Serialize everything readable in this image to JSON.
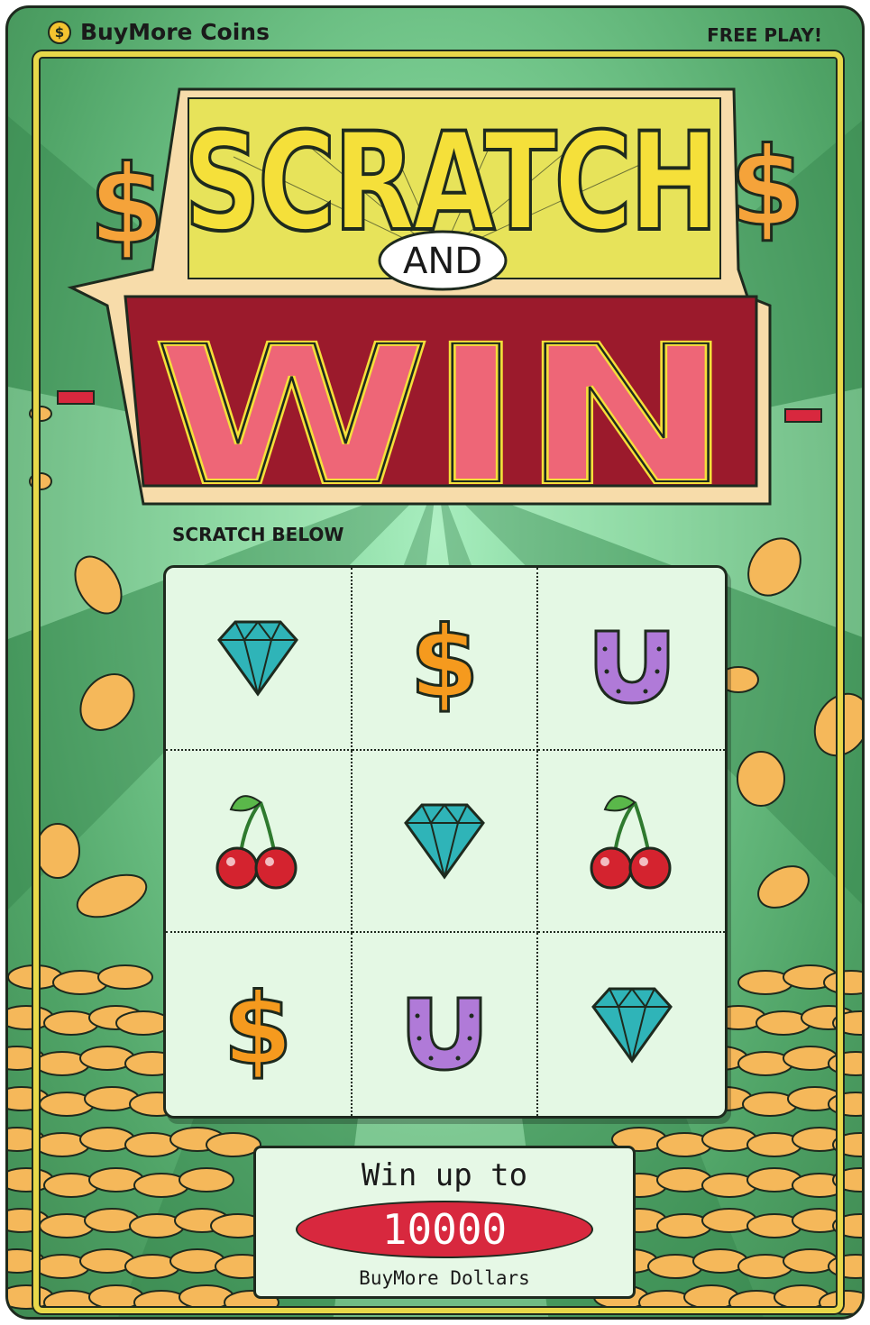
{
  "header": {
    "brand_icon_glyph": "$",
    "brand_name": "BuyMore Coins",
    "mode_label": "FREE PLAY!"
  },
  "logo": {
    "line1": "SCRATCH",
    "line2": "AND",
    "line3": "WIN"
  },
  "instruction": "SCRATCH BELOW",
  "grid": {
    "cells": [
      {
        "symbol": "diamond"
      },
      {
        "symbol": "dollar"
      },
      {
        "symbol": "horseshoe"
      },
      {
        "symbol": "cherry"
      },
      {
        "symbol": "diamond"
      },
      {
        "symbol": "cherry"
      },
      {
        "symbol": "dollar"
      },
      {
        "symbol": "horseshoe"
      },
      {
        "symbol": "diamond"
      }
    ]
  },
  "prize": {
    "title": "Win up to",
    "amount": "10000",
    "unit": "BuyMore Dollars"
  },
  "colors": {
    "card_green": "#4fa366",
    "frame_yellow": "#e8d84a",
    "win_red": "#d8283e",
    "win_pink": "#ee6677",
    "scratch_yellow": "#f5e03a",
    "coin_gold": "#f5b85a",
    "diamond_teal": "#2fb4b8",
    "horseshoe_purple": "#b07ad8",
    "cherry_red": "#d4232f",
    "dollar_orange": "#f59a1e"
  }
}
